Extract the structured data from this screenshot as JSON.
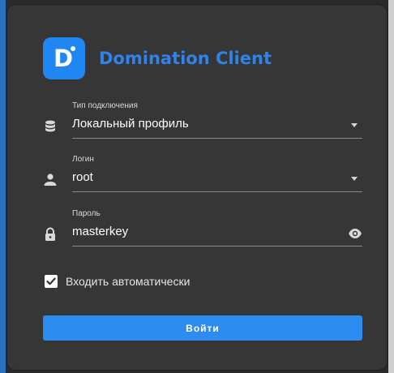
{
  "app": {
    "title": "Domination Client",
    "logo_letter": "D"
  },
  "form": {
    "connection_type": {
      "label": "Тип подключения",
      "value": "Локальный профиль",
      "icon": "database-icon"
    },
    "login": {
      "label": "Логин",
      "value": "root",
      "icon": "user-icon"
    },
    "password": {
      "label": "Пароль",
      "value": "masterkey",
      "icon": "lock-icon",
      "toggle_icon": "eye-icon"
    },
    "auto_login": {
      "label": "Входить автоматически",
      "checked": true
    },
    "submit_label": "Войти"
  },
  "colors": {
    "accent": "#2d8cf0",
    "title": "#2f83ea",
    "background": "#363636"
  }
}
